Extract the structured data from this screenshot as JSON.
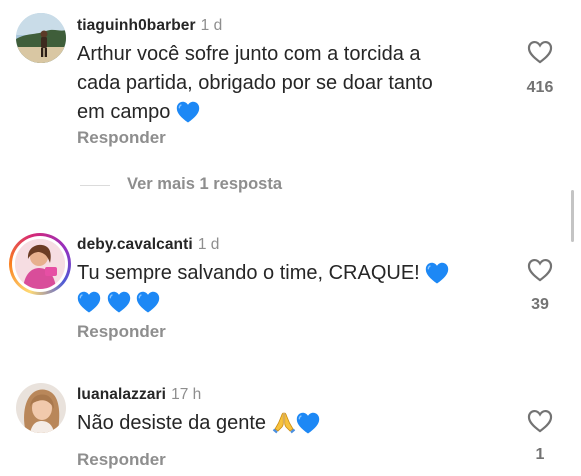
{
  "comments": [
    {
      "username": "tiaguinh0barber",
      "time": "1 d",
      "lines": [
        "Arthur você sofre junto com a torcida a",
        "cada partida, obrigado por se doar tanto",
        "em campo"
      ],
      "emoji": [
        "blue-heart"
      ],
      "reply_label": "Responder",
      "likes": "416"
    },
    {
      "username": "deby.cavalcanti",
      "time": "1 d",
      "lines": [
        "Tu sempre salvando o time, CRAQUE!"
      ],
      "emoji": [
        "blue-heart",
        "blue-heart",
        "blue-heart",
        "blue-heart"
      ],
      "reply_label": "Responder",
      "likes": "39"
    },
    {
      "username": "luanalazzari",
      "time": "17 h",
      "lines": [
        "Não desiste da gente"
      ],
      "emoji": [
        "folded-hands",
        "blue-heart"
      ],
      "reply_label": "Responder",
      "likes": "1"
    }
  ],
  "view_more": "Ver mais 1 resposta",
  "colors": {
    "text": "#262626",
    "muted": "#8e8e8e",
    "heart_blue": "#1d88f5",
    "story_ring": "#d62976"
  }
}
